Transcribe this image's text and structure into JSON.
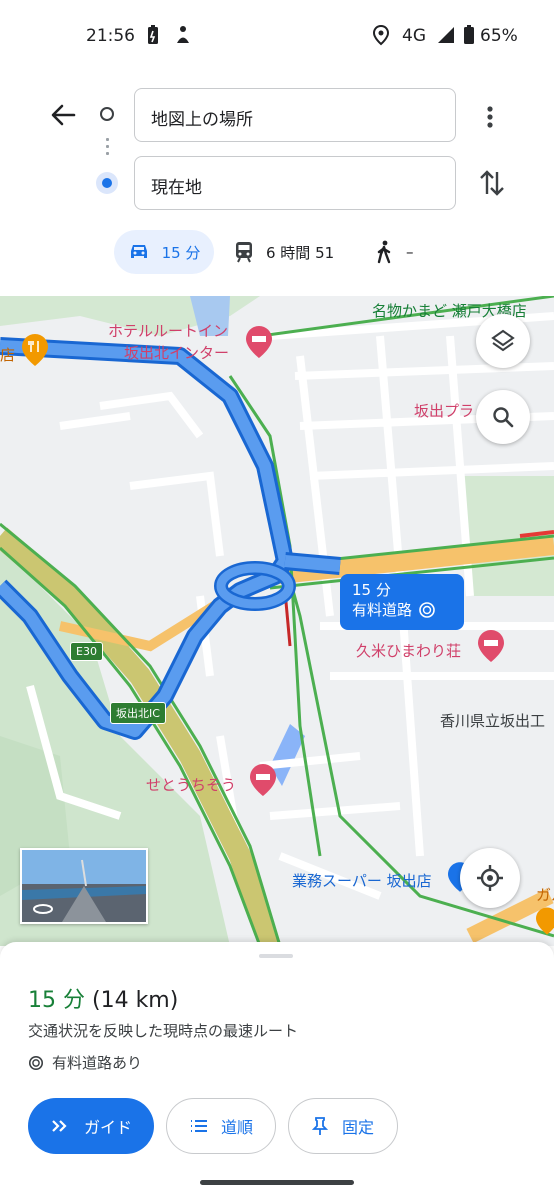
{
  "status_bar": {
    "time": "21:56",
    "network": "4G",
    "battery": "65%",
    "icons": [
      "battery-saver-icon",
      "accessibility-icon",
      "location-icon",
      "signal-icon",
      "battery-icon"
    ]
  },
  "directions": {
    "origin": "地図上の場所",
    "destination": "現在地",
    "modes": [
      {
        "name": "car-icon",
        "label": "15 分"
      },
      {
        "name": "transit-icon",
        "label": "6 時間 51"
      },
      {
        "name": "walk-icon",
        "label": "–"
      }
    ]
  },
  "map": {
    "labels": {
      "hotel": "ホテルルートイン",
      "hotel2": "坂出北インター",
      "famous": "名物かまど 瀬戸大橋店",
      "shop_left": "店",
      "plaza": "坂出プラ",
      "kume": "久米ひまわり荘",
      "school": "香川県立坂出工",
      "setouchi": "せとうちそう",
      "super": "業務スーパー 坂出店",
      "right_edge": "ガル"
    },
    "shields": {
      "e30": "E30",
      "ic": "坂出北IC"
    },
    "eta_bubble": {
      "line1": "15 分",
      "line2": "有料道路"
    }
  },
  "sheet": {
    "duration": "15 分",
    "distance": "(14 km)",
    "description": "交通状況を反映した現時点の最速ルート",
    "toll": "有料道路あり",
    "buttons": {
      "guide": "ガイド",
      "steps": "道順",
      "pin": "固定"
    }
  },
  "colors": {
    "accent": "#1a73e8",
    "route": "#4a90e2",
    "green": "#188038"
  }
}
